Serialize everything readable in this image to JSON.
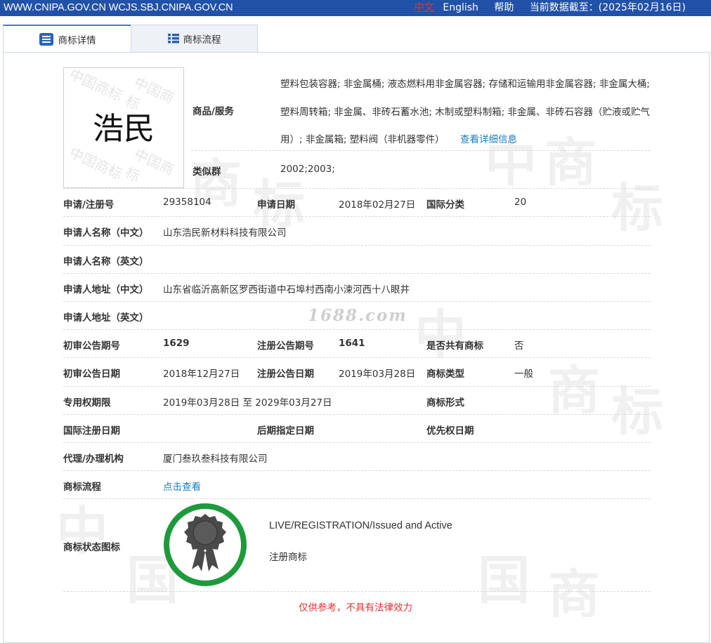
{
  "topbar": {
    "domains": "WWW.CNIPA.GOV.CN WCJS.SBJ.CNIPA.GOV.CN",
    "lang_zh": "中文",
    "lang_en": "English",
    "help": "帮助",
    "data_cutoff": "当前数据截至：(2025年02月16日)"
  },
  "tabs": [
    {
      "label": "商标详情",
      "icon": "document-icon",
      "active": true
    },
    {
      "label": "商标流程",
      "icon": "list-icon",
      "active": false
    }
  ],
  "trademark": {
    "image_text": "浩民",
    "image_watermark": "中国商标"
  },
  "goods": {
    "label": "商品/服务",
    "text": "塑料包装容器; 非金属桶; 液态燃料用非金属容器; 存储和运输用非金属容器; 非金属大桶; 塑料周转箱; 非金属、非砖石蓄水池; 木制或塑料制箱; 非金属、非砖石容器（贮液或贮气用）; 非金属箱; 塑料阀（非机器零件）",
    "detail_link": "查看详细信息"
  },
  "similar_group": {
    "label": "类似群",
    "value": "2002;2003;"
  },
  "fields": {
    "reg_no_label": "申请/注册号",
    "reg_no": "29358104",
    "app_date_label": "申请日期",
    "app_date": "2018年02月27日",
    "intl_class_label": "国际分类",
    "intl_class": "20",
    "applicant_cn_label": "申请人名称（中文）",
    "applicant_cn": "山东浩民新材料科技有限公司",
    "applicant_en_label": "申请人名称（英文）",
    "applicant_en": "",
    "address_cn_label": "申请人地址（中文）",
    "address_cn": "山东省临沂高新区罗西街道中石埠村西南小涑河西十八眼井",
    "address_en_label": "申请人地址（英文）",
    "address_en": "",
    "prelim_issue_label": "初审公告期号",
    "prelim_issue": "1629",
    "reg_issue_label": "注册公告期号",
    "reg_issue": "1641",
    "shared_label": "是否共有商标",
    "shared": "否",
    "prelim_date_label": "初审公告日期",
    "prelim_date": "2018年12月27日",
    "reg_date_label": "注册公告日期",
    "reg_date": "2019年03月28日",
    "tm_type_label": "商标类型",
    "tm_type": "一般",
    "exclusive_label": "专用权期限",
    "exclusive": "2019年03月28日 至 2029年03月27日",
    "tm_form_label": "商标形式",
    "tm_form": "",
    "intl_reg_date_label": "国际注册日期",
    "intl_reg_date": "",
    "later_designation_label": "后期指定日期",
    "later_designation": "",
    "priority_date_label": "优先权日期",
    "priority_date": "",
    "agent_label": "代理/办理机构",
    "agent": "厦门叁玖叁科技有限公司",
    "process_label": "商标流程",
    "process_link": "点击查看"
  },
  "status": {
    "label": "商标状态图标",
    "icon": "registered-seal-icon",
    "en": "LIVE/REGISTRATION/Issued and Active",
    "cn": "注册商标"
  },
  "watermark": "1688.com",
  "notice": "仅供参考，不具有法律效力",
  "colors": {
    "topbar": "#1d4ea5",
    "link": "#1a7fc1",
    "notice": "#e03131",
    "badge_ring": "#1e9a3c"
  }
}
